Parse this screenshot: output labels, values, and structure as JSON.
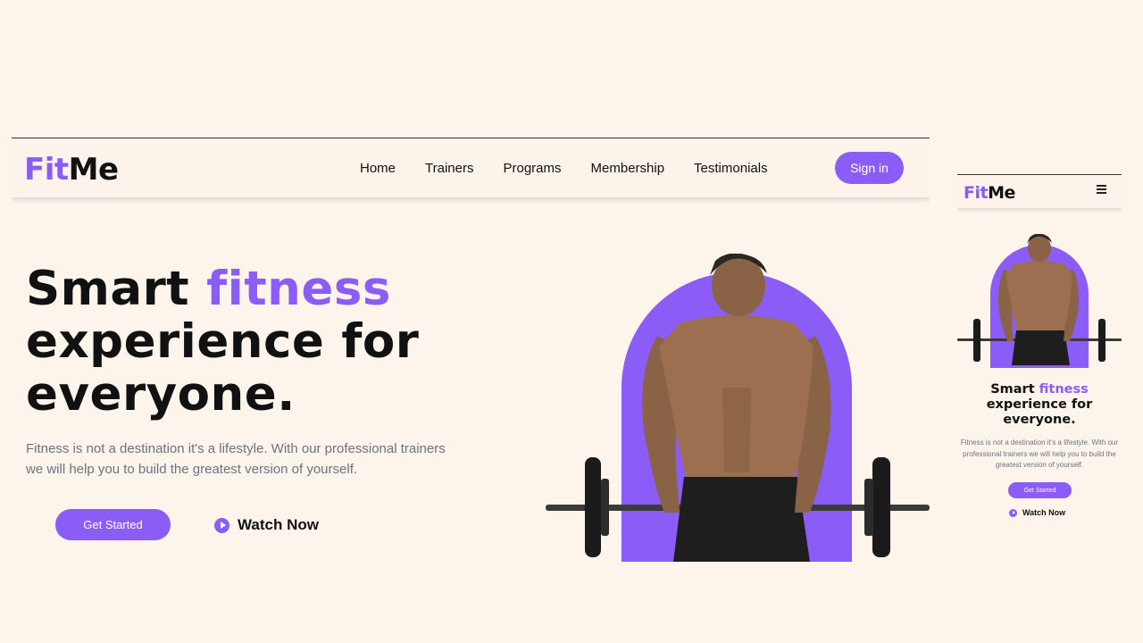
{
  "brand": {
    "part1": "Fit",
    "part2": "Me",
    "accent_color": "#8b5cf6"
  },
  "nav": {
    "links": [
      "Home",
      "Trainers",
      "Programs",
      "Membership",
      "Testimonials"
    ],
    "signin_label": "Sign in"
  },
  "hero": {
    "headline_pre": "Smart ",
    "headline_accent": "fitness",
    "headline_line2": "experience for",
    "headline_line3": "everyone.",
    "description": "Fitness is not a destination it's a lifestyle. With our professional trainers we will help you to build the greatest version of yourself.",
    "cta_label": "Get Started",
    "watch_label": "Watch Now"
  },
  "mobile": {
    "menu_icon": "hamburger-menu-icon",
    "headline_line2": "experience for"
  },
  "icons": {
    "play": "play-icon",
    "menu": "hamburger-menu-icon"
  },
  "colors": {
    "background": "#fdf4ea",
    "accent": "#8b5cf6",
    "text": "#111111",
    "muted": "#6b7280"
  }
}
